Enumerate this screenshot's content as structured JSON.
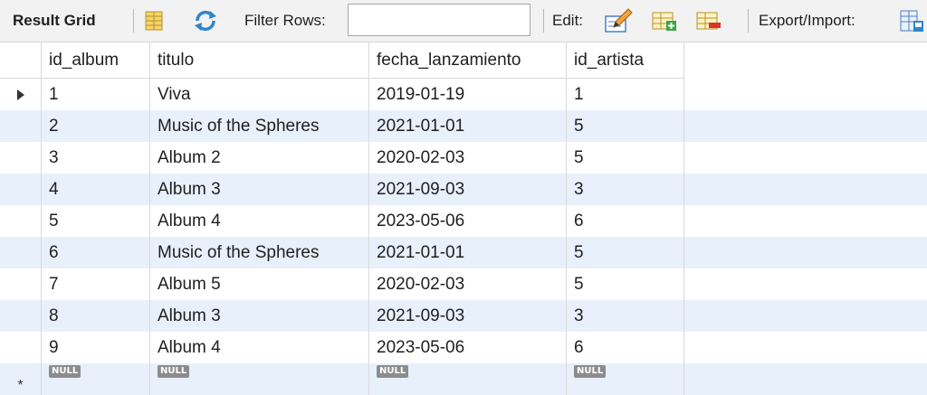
{
  "toolbar": {
    "result_grid_label": "Result Grid",
    "filter_rows_label": "Filter Rows:",
    "filter_rows_value": "",
    "edit_label": "Edit:",
    "export_import_label": "Export/Import:",
    "icons": [
      "grid-form-toggle-icon",
      "refresh-icon",
      "edit-pencil-icon",
      "add-row-icon",
      "delete-row-icon",
      "export-import-icon"
    ]
  },
  "table": {
    "columns": [
      "id_album",
      "titulo",
      "fecha_lanzamiento",
      "id_artista"
    ],
    "rows": [
      [
        "1",
        "Viva",
        "2019-01-19",
        "1"
      ],
      [
        "2",
        "Music of the Spheres",
        "2021-01-01",
        "5"
      ],
      [
        "3",
        "Album 2",
        "2020-02-03",
        "5"
      ],
      [
        "4",
        "Album 3",
        "2021-09-03",
        "3"
      ],
      [
        "5",
        "Album 4",
        "2023-05-06",
        "6"
      ],
      [
        "6",
        "Music of the Spheres",
        "2021-01-01",
        "5"
      ],
      [
        "7",
        "Album 5",
        "2020-02-03",
        "5"
      ],
      [
        "8",
        "Album 3",
        "2021-09-03",
        "3"
      ],
      [
        "9",
        "Album 4",
        "2023-05-06",
        "6"
      ]
    ],
    "new_row": [
      "NULL",
      "NULL",
      "NULL",
      "NULL"
    ],
    "selected_row_index": 0,
    "colors": {
      "row_odd": "#ffffff",
      "row_even": "#e8f0fb",
      "null_badge": "#8c8c8c"
    }
  }
}
